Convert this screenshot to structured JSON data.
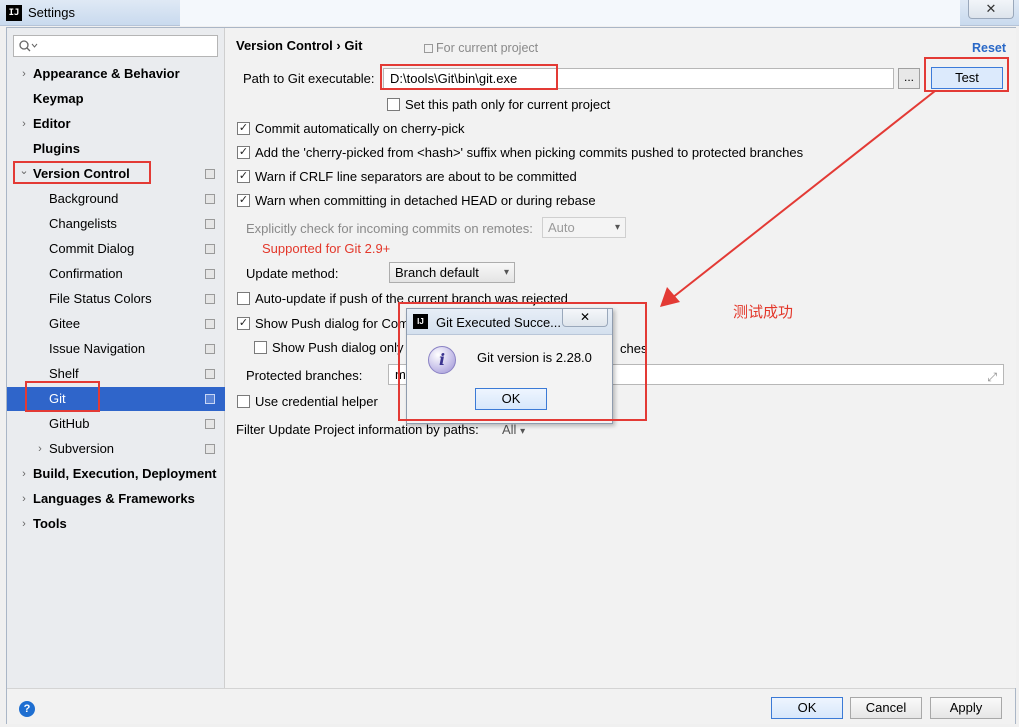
{
  "window": {
    "title": "Settings",
    "close_glyph": "✕"
  },
  "sidebar": {
    "search_placeholder": "",
    "items": [
      {
        "label": "Appearance & Behavior",
        "arrow": "›"
      },
      {
        "label": "Keymap"
      },
      {
        "label": "Editor",
        "arrow": "›"
      },
      {
        "label": "Plugins"
      },
      {
        "label": "Version Control",
        "arrow": "⌄"
      },
      {
        "label": "Background"
      },
      {
        "label": "Changelists"
      },
      {
        "label": "Commit Dialog"
      },
      {
        "label": "Confirmation"
      },
      {
        "label": "File Status Colors"
      },
      {
        "label": "Gitee"
      },
      {
        "label": "Issue Navigation"
      },
      {
        "label": "Shelf"
      },
      {
        "label": "Git"
      },
      {
        "label": "GitHub"
      },
      {
        "label": "Subversion",
        "arrow": "›"
      },
      {
        "label": "Build, Execution, Deployment",
        "arrow": "›"
      },
      {
        "label": "Languages & Frameworks",
        "arrow": "›"
      },
      {
        "label": "Tools",
        "arrow": "›"
      }
    ]
  },
  "content": {
    "breadcrumb": "Version Control  ›  Git",
    "for_project": "For current project",
    "reset": "Reset",
    "path_label": "Path to Git executable:",
    "path_value": "D:\\tools\\Git\\bin\\git.exe",
    "browse": "...",
    "test": "Test",
    "set_path_only": "Set this path only for current project",
    "commit_cherry": "Commit automatically on cherry-pick",
    "add_cherry_suffix": "Add the 'cherry-picked from <hash>' suffix when picking commits pushed to protected branches",
    "warn_crlf": "Warn if CRLF line separators are about to be committed",
    "warn_detached": "Warn when committing in detached HEAD or during rebase",
    "explicit_check": "Explicitly check for incoming commits on remotes:",
    "explicit_value": "Auto",
    "supported_git": "Supported for Git 2.9+",
    "update_method_label": "Update method:",
    "update_method_value": "Branch default",
    "auto_update": "Auto-update if push of the current branch was rejected",
    "show_push_dialog": "Show Push dialog for Com",
    "show_push_dialog_only": "Show Push dialog only",
    "show_push_dialog_tail": "ches",
    "protected_branches_label": "Protected branches:",
    "protected_branches_value": "ma",
    "use_credential": "Use credential helper",
    "filter_update": "Filter Update Project information by paths:",
    "filter_value": "All"
  },
  "dialog": {
    "title": "Git Executed Succe...",
    "close": "✕",
    "message": "Git version is 2.28.0",
    "ok": "OK",
    "icon": "info-icon"
  },
  "footer": {
    "help": "?",
    "ok": "OK",
    "cancel": "Cancel",
    "apply": "Apply"
  },
  "annotation": {
    "text": "测试成功"
  },
  "colors": {
    "highlight": "#e33a35",
    "selection": "#2f65ca",
    "link": "#2968c7"
  }
}
